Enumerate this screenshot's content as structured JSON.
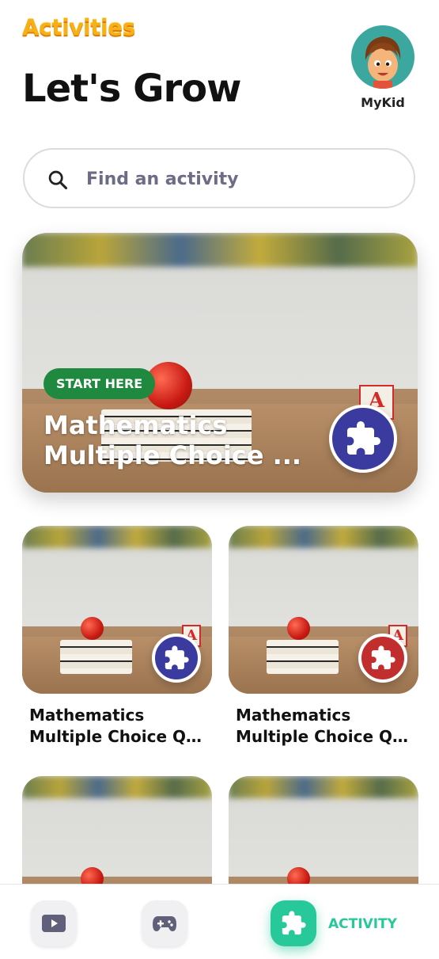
{
  "header": {
    "app_title": "Activities",
    "page_title": "Let's Grow",
    "profile_name": "MyKid"
  },
  "search": {
    "placeholder": "Find an activity",
    "value": ""
  },
  "featured": {
    "badge": "START HERE",
    "title": "Mathematics Multiple Choice ...",
    "block_letter": "A",
    "button_color": "#3b3a9e"
  },
  "cards": [
    {
      "title_line1": "Mathematics",
      "title_line2": "Multiple Choice Qu...",
      "button_color": "#3b3a9e",
      "block_letter": "A"
    },
    {
      "title_line1": "Mathematics",
      "title_line2": "Multiple Choice Qu...",
      "button_color": "#c22d2d",
      "block_letter": "A"
    }
  ],
  "bottom_nav": {
    "items": [
      {
        "icon": "play-icon"
      },
      {
        "icon": "gamepad-icon"
      },
      {
        "icon": "puzzle-icon",
        "label": "ACTIVITY",
        "active": true
      }
    ],
    "active_color": "#27c99a"
  }
}
